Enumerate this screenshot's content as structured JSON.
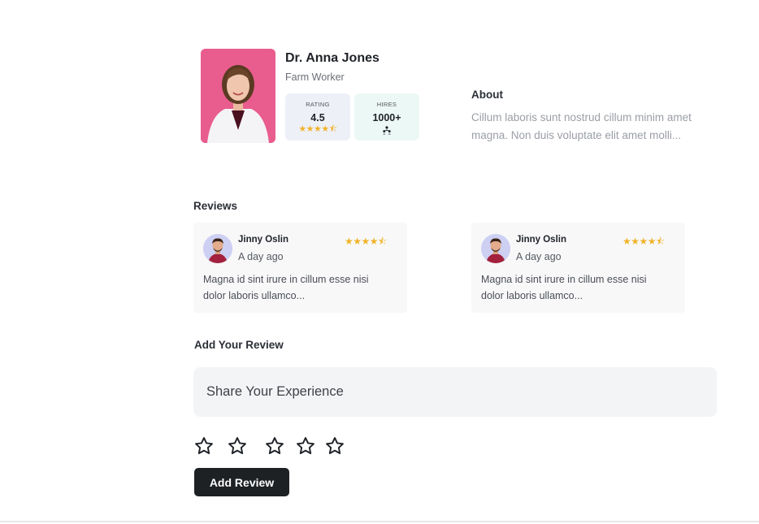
{
  "profile": {
    "name": "Dr. Anna Jones",
    "role": "Farm Worker",
    "photo_bg": "#e85d8e",
    "rating_label": "RATING",
    "rating_value": "4.5",
    "rating_stars": "★★★★⯪",
    "hires_label": "HIRES",
    "hires_value": "1000+",
    "hires_icon": "people-group-icon"
  },
  "about": {
    "title": "About",
    "text": "Cillum laboris sunt nostrud cillum minim amet magna. Non duis voluptate elit amet molli..."
  },
  "reviews": {
    "title": "Reviews",
    "items": [
      {
        "name": "Jinny Oslin",
        "time": "A day ago",
        "stars": "★★★★⯪",
        "text": "Magna id sint irure in cillum esse nisi dolor laboris ullamco..."
      },
      {
        "name": "Jinny Oslin",
        "time": "A day ago",
        "stars": "★★★★⯪",
        "text": "Magna id sint irure in cillum esse nisi dolor laboris ullamco..."
      }
    ]
  },
  "add_review": {
    "title": "Add Your Review",
    "placeholder": "Share Your Experience",
    "star_rating": 0,
    "star_count": 5,
    "button_label": "Add Review"
  },
  "colors": {
    "accent_star": "#f0b429",
    "button_bg": "#1e2124",
    "input_bg": "#f3f4f6"
  }
}
